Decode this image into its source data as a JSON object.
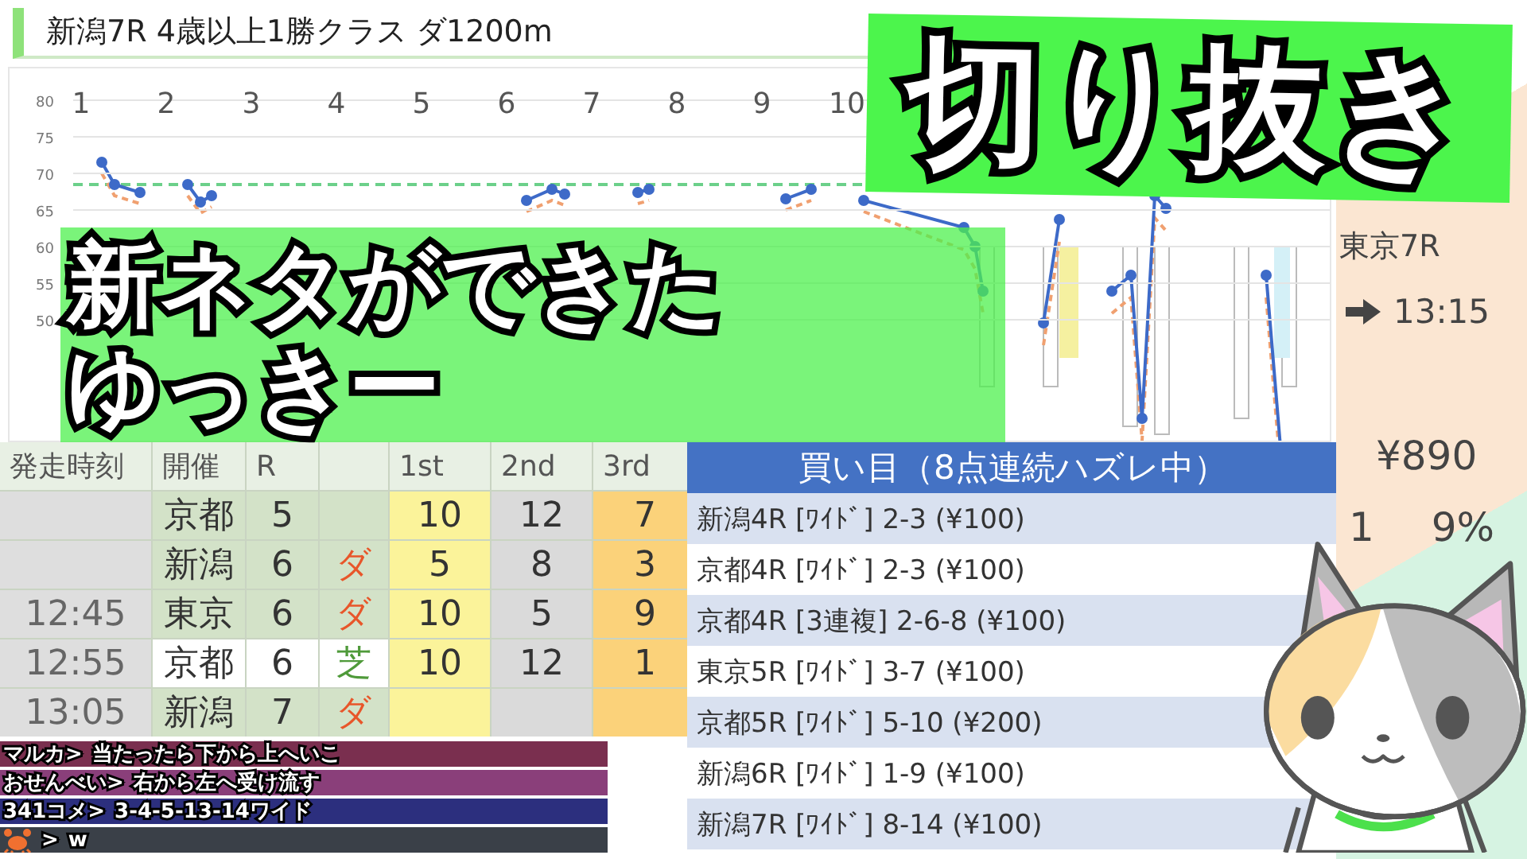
{
  "title": "新潟7R 4歳以上1勝クラス ダ1200m",
  "chart": {
    "yticks": [
      "80",
      "75",
      "70",
      "65",
      "60",
      "55",
      "50"
    ],
    "horse_numbers": [
      "1",
      "2",
      "3",
      "4",
      "5",
      "6",
      "7",
      "8",
      "9",
      "10"
    ]
  },
  "race_table": {
    "columns": [
      "発走時刻",
      "開催",
      "R",
      "1st",
      "2nd",
      "3rd"
    ],
    "rows": [
      {
        "venue": "京都",
        "race": "5",
        "first": "10",
        "second": "12",
        "third": "7",
        "highlighted": false
      },
      {
        "venue": "新潟",
        "race": "6",
        "surface": {
          "text": "ダ",
          "color": "#e8562a"
        },
        "first": "5",
        "second": "8",
        "third": "3",
        "highlighted": false
      },
      {
        "time": "12:45",
        "venue": "東京",
        "race": "6",
        "surface": {
          "text": "ダ",
          "color": "#e8562a"
        },
        "first": "10",
        "second": "5",
        "third": "9",
        "highlighted": false
      },
      {
        "time": "12:55",
        "venue": "京都",
        "race": "6",
        "surface": {
          "text": "芝",
          "color": "#4f9a3a"
        },
        "first": "10",
        "second": "12",
        "third": "1",
        "highlighted": true
      },
      {
        "time": "13:05",
        "venue": "新潟",
        "race": "7",
        "surface": {
          "text": "ダ",
          "color": "#e8562a"
        },
        "highlighted": false
      }
    ]
  },
  "bets": {
    "title": "買い目（8点連続ハズレ中）",
    "items": [
      "新潟4R [ﾜｲﾄﾞ] 2-3 (¥100)",
      "京都4R [ﾜｲﾄﾞ] 2-3 (¥100)",
      "京都4R [3連複] 2-6-8 (¥100)",
      "東京5R [ﾜｲﾄﾞ] 3-7 (¥100)",
      "京都5R [ﾜｲﾄﾞ] 5-10 (¥200)",
      "新潟6R [ﾜｲﾄﾞ] 1-9 (¥100)",
      "新潟7R [ﾜｲﾄﾞ] 8-14 (¥100)"
    ]
  },
  "side": {
    "next_race": "東京7R",
    "next_time": "13:15",
    "balance": "¥890",
    "rate_start": "1",
    "rate_end": "9%"
  },
  "banner": "切り抜き",
  "headline": [
    "新ネタができた",
    "ゆっきー"
  ],
  "chat": [
    {
      "kind": "text",
      "name": "マルカ>",
      "text": "当たったら下から上へいこ",
      "color": "#7a2f4f"
    },
    {
      "kind": "text",
      "name": "おせんべい>",
      "text": "右から左へ受け流す",
      "color": "#8a3f7a"
    },
    {
      "kind": "text",
      "name": "341コメ>",
      "text": "3-4-5-13-14ワイド",
      "color": "#2c2f7e"
    },
    {
      "kind": "icon",
      "name": ">",
      "text": "w",
      "color": "#3a4048"
    }
  ]
}
